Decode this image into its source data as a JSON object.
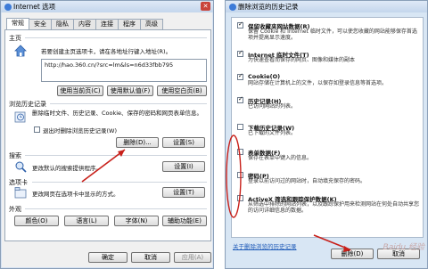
{
  "left_window": {
    "title": "Internet 选项",
    "close": "✕",
    "tabs": [
      "常规",
      "安全",
      "隐私",
      "内容",
      "连接",
      "程序",
      "高级"
    ],
    "home": {
      "section": "主页",
      "desc": "若要创建主页选项卡，请在各地址行键入地址(R)。",
      "url_line1": "http://hao.360.cn/?src=lm&ls=n6d33fbb795",
      "url_line2": "",
      "btn_current": "使用当前页(C)",
      "btn_default": "使用默认值(F)",
      "btn_blank": "使用空白页(B)"
    },
    "history": {
      "section": "浏览历史记录",
      "desc": "删除临时文件、历史记录、Cookie、保存的密码和网页表单信息。",
      "checkbox_label": "退出时删除浏览历史记录(W)",
      "checkbox_checked": false,
      "btn_delete": "删除(D)...",
      "btn_settings": "设置(S)"
    },
    "search": {
      "section": "搜索",
      "desc": "更改默认的搜索提供程序。",
      "btn_settings": "设置(I)"
    },
    "tabs_section": {
      "section": "选项卡",
      "desc": "更改网页在选项卡中显示的方式。",
      "btn_settings": "设置(T)"
    },
    "appearance": {
      "section": "外观",
      "btn_colors": "颜色(O)",
      "btn_languages": "语言(L)",
      "btn_fonts": "字体(N)",
      "btn_accessibility": "辅助功能(E)"
    },
    "footer": {
      "ok": "确定",
      "cancel": "取消",
      "apply": "应用(A)"
    }
  },
  "right_window": {
    "title": "删除浏览的历史记录",
    "items": [
      {
        "heading": "保留收藏夹网站数据(R)",
        "desc": "保留 Cookie 和 Internet 临时文件，可以使您收藏的网站能够保存首选项并提高显示速度。",
        "checked": true
      },
      {
        "heading": "Internet 临时文件(T)",
        "desc": "为快速查看而保存的网页、图像和媒体的副本",
        "checked": true
      },
      {
        "heading": "Cookie(O)",
        "desc": "网站存储在计算机上的文件，以保存如登录信息等首选项。",
        "checked": true
      },
      {
        "heading": "历史记录(H)",
        "desc": "已访问网站的列表。",
        "checked": true
      },
      {
        "heading": "下载历史记录(W)",
        "desc": "已下载的文件列表。",
        "checked": false
      },
      {
        "heading": "表单数据(F)",
        "desc": "保存在表单中键入的信息。",
        "checked": false
      },
      {
        "heading": "密码(P)",
        "desc": "登录以前访问过的网站时，自动填充保存的密码。",
        "checked": false
      },
      {
        "heading": "ActiveX 筛选和跟踪保护数据(K)",
        "desc": "从筛选中排除的网站列表，以及跟踪保护用来检测网站在何处自动共享您的访问详细信息的数据。",
        "checked": false
      }
    ],
    "link_about": "关于删除浏览的历史记录",
    "btn_delete": "删除(D)",
    "btn_cancel": "取消"
  },
  "watermark": "Baidu 经验",
  "colors": {
    "annotation": "#c8201a",
    "link": "#1f5bb8"
  }
}
